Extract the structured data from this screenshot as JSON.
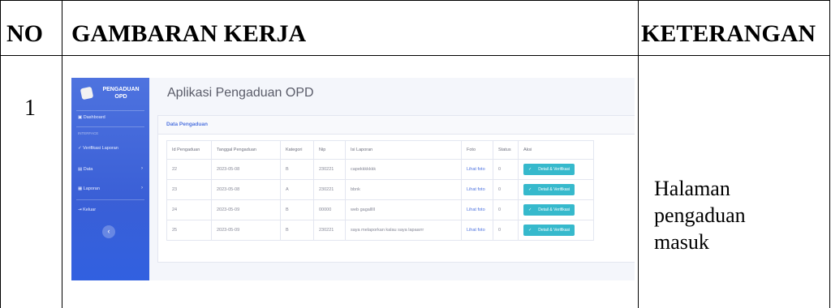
{
  "doc": {
    "headers": {
      "no": "NO",
      "gambaran": "GAMBARAN KERJA",
      "keterangan": "KETERANGAN"
    },
    "row_number": "1",
    "note_lines": [
      "Halaman",
      "pengaduan",
      "masuk"
    ]
  },
  "app": {
    "brand": "PENGADUAN OPD",
    "title": "Aplikasi Pengaduan OPD",
    "sidebar": {
      "dashboard": "Dashboard",
      "section": "INTERFACE",
      "items": [
        "Verifikasi Laporan",
        "Data",
        "Laporan",
        "Keluar"
      ],
      "toggle_icon": "chevron-left-icon"
    },
    "card_title": "Data Pengaduan",
    "columns": [
      "Id Pengaduan",
      "Tanggal Pengaduan",
      "Kategori",
      "Nip",
      "Isi Laporan",
      "Foto",
      "Status",
      "Aksi"
    ],
    "rows": [
      {
        "id": "22",
        "tanggal": "2023-05-08",
        "kategori": "B",
        "nip": "230221",
        "isi": "capekkkkkkk",
        "foto": "Lihat foto",
        "status": "0",
        "aksi": "Detail & Verifikasi"
      },
      {
        "id": "23",
        "tanggal": "2023-05-08",
        "kategori": "A",
        "nip": "230221",
        "isi": "bbnk",
        "foto": "Lihat foto",
        "status": "0",
        "aksi": "Detail & Verifikasi"
      },
      {
        "id": "24",
        "tanggal": "2023-05-09",
        "kategori": "B",
        "nip": "00000",
        "isi": "web gagalllll",
        "foto": "Lihat foto",
        "status": "0",
        "aksi": "Detail & Verifikasi"
      },
      {
        "id": "25",
        "tanggal": "2023-05-09",
        "kategori": "B",
        "nip": "230221",
        "isi": "saya melaporkan kalau saya lapaarrr",
        "foto": "Lihat foto",
        "status": "0",
        "aksi": "Detail & Verifikasi"
      }
    ],
    "colors": {
      "sidebar": "#4e73df",
      "button": "#36b9cc"
    }
  }
}
